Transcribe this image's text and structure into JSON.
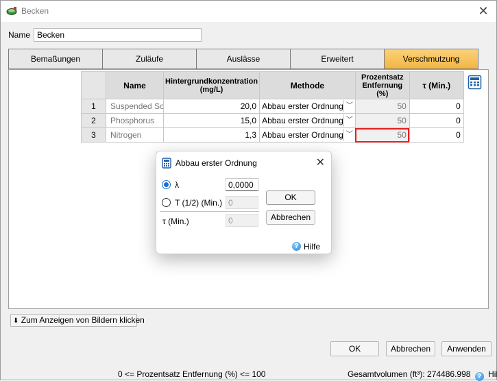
{
  "window": {
    "title": "Becken"
  },
  "name_field": {
    "label": "Name",
    "value": "Becken"
  },
  "tabs": [
    {
      "label": "Bemaßungen",
      "active": false
    },
    {
      "label": "Zuläufe",
      "active": false
    },
    {
      "label": "Auslässe",
      "active": false
    },
    {
      "label": "Erweitert",
      "active": false
    },
    {
      "label": "Verschmutzung",
      "active": true
    }
  ],
  "grid": {
    "headers": {
      "name": "Name",
      "concentration": "Hintergrundkonzentration (mg/L)",
      "method": "Methode",
      "removal": "Prozentsatz Entfernung (%)",
      "tau": "τ (Min.)"
    },
    "rows": [
      {
        "num": "1",
        "name": "Suspended Solids",
        "concentration": "20,0",
        "method": "Abbau erster Ordnung",
        "removal": "50",
        "tau": "0"
      },
      {
        "num": "2",
        "name": "Phosphorus",
        "concentration": "15,0",
        "method": "Abbau erster Ordnung",
        "removal": "50",
        "tau": "0"
      },
      {
        "num": "3",
        "name": "Nitrogen",
        "concentration": "1,3",
        "method": "Abbau erster Ordnung",
        "removal": "50",
        "tau": "0"
      }
    ]
  },
  "dialog": {
    "title": "Abbau erster Ordnung",
    "lambda_label": "λ",
    "lambda_value": "0,0000",
    "t_half_label": "T (1/2) (Min.)",
    "t_half_value": "0",
    "tau_label": "τ (Min.)",
    "tau_value": "0",
    "ok_label": "OK",
    "cancel_label": "Abbrechen",
    "help_label": "Hilfe"
  },
  "show_images_button": "Zum Anzeigen von Bildern klicken",
  "buttons": {
    "ok": "OK",
    "cancel": "Abbrechen",
    "apply": "Anwenden"
  },
  "status": {
    "constraint": "0 <= Prozentsatz Entfernung (%) <= 100",
    "total_volume": "Gesamtvolumen (ft³): 274486.998",
    "help": "Hilfe"
  },
  "colors": {
    "active_tab": "#f3b544",
    "selection": "#e02020",
    "radio_accent": "#1a6fd0"
  }
}
